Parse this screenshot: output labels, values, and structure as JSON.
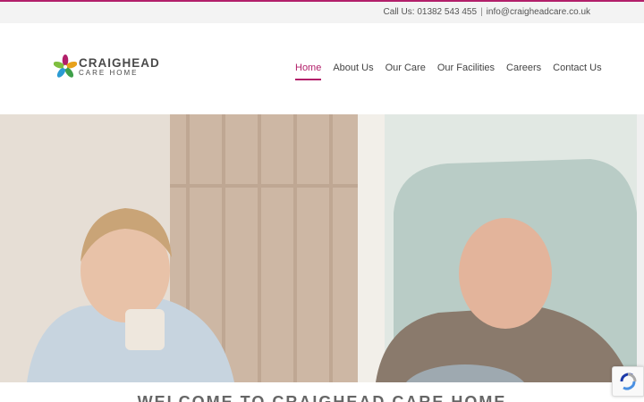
{
  "topbar": {
    "phone": "Call Us: 01382 543 455",
    "separator": "|",
    "email": "info@craigheadcare.co.uk"
  },
  "logo": {
    "name": "CRAIGHEAD",
    "sub": "CARE HOME"
  },
  "nav": {
    "items": [
      {
        "label": "Home",
        "active": true
      },
      {
        "label": "About Us"
      },
      {
        "label": "Our Care"
      },
      {
        "label": "Our Facilities"
      },
      {
        "label": "Careers"
      },
      {
        "label": "Contact Us"
      }
    ]
  },
  "hero": {
    "image": "photo of a smiling nurse holding a mug beside a laughing elderly man in an armchair"
  },
  "main": {
    "heading": "WELCOME TO CRAIGHEAD CARE HOME"
  },
  "colors": {
    "accent": "#b21f6a",
    "petal_colors": [
      "#b21f6a",
      "#e8a21b",
      "#2b9bd3",
      "#3fa04a",
      "#7fbf3f"
    ]
  },
  "icons": {
    "logo_mark": "flower-logo-icon",
    "recaptcha": "recaptcha-icon"
  }
}
